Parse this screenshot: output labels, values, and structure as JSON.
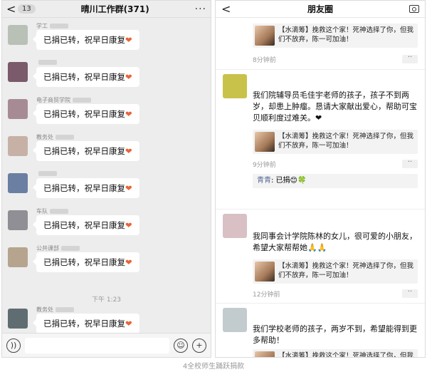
{
  "group_chat": {
    "back_label": "<",
    "unread_badge": "13",
    "title": "晴川工作群(371)",
    "more_label": "···",
    "messages": [
      {
        "sender": "学工",
        "text": "已捐已转，祝早日康复",
        "heart": "❤"
      },
      {
        "sender": "",
        "text": "已捐已转，祝早日康复",
        "heart": "❤"
      },
      {
        "sender": "电子商贸学院",
        "text": "已捐已转，祝早日康复",
        "heart": "❤"
      },
      {
        "sender": "教务处",
        "text": "已捐已转，祝早日康复",
        "heart": "❤"
      },
      {
        "sender": "",
        "text": "已捐已转，祝早日康复",
        "heart": "❤"
      },
      {
        "sender": "车队",
        "text": "已捐已转，祝早日康复",
        "heart": "❤"
      },
      {
        "sender": "公共课部",
        "text": "已捐已转，祝早日康复",
        "heart": "❤"
      },
      {
        "sender": "教务处",
        "text": "已捐已转，祝早日康复",
        "heart": "❤"
      }
    ],
    "time_separator": "下午 1:23",
    "input": {
      "voice_icon": "voice-icon",
      "emoji_icon": "emoji-icon",
      "plus_icon": "plus-icon",
      "placeholder": ""
    }
  },
  "moments": {
    "back_label": "<",
    "title": "朋友圈",
    "camera_icon": "camera-icon",
    "share_text": "【水滴筹】挽救这个家！死神选择了你，但我们不放弃，陈一可加油！",
    "posts": [
      {
        "text": "",
        "time": "8分钟前",
        "comment": null
      },
      {
        "text": "我们院辅导员毛佳宇老师的孩子，孩子不到两岁，却患上肿瘤。恳请大家献出爱心，帮助可宝贝顺利度过难关。❤",
        "time": "9分钟前",
        "comment": {
          "name": "青青",
          "text": ": 已捐😊🍀"
        }
      },
      {
        "text": "我同事会计学院陈林的女儿，很可爱的小朋友，希望大家帮帮她🙏🙏",
        "time": "12分钟前",
        "comment": null
      },
      {
        "text": "我们学校老师的孩子，两岁不到，希望能得到更多帮助！",
        "time": "",
        "comment": null
      }
    ],
    "more_dots": "··"
  },
  "caption": "4全校师生踊跃捐款",
  "colors": {
    "link": "#576b95",
    "heart": "#e8643a",
    "chat_bg": "#ededed"
  }
}
